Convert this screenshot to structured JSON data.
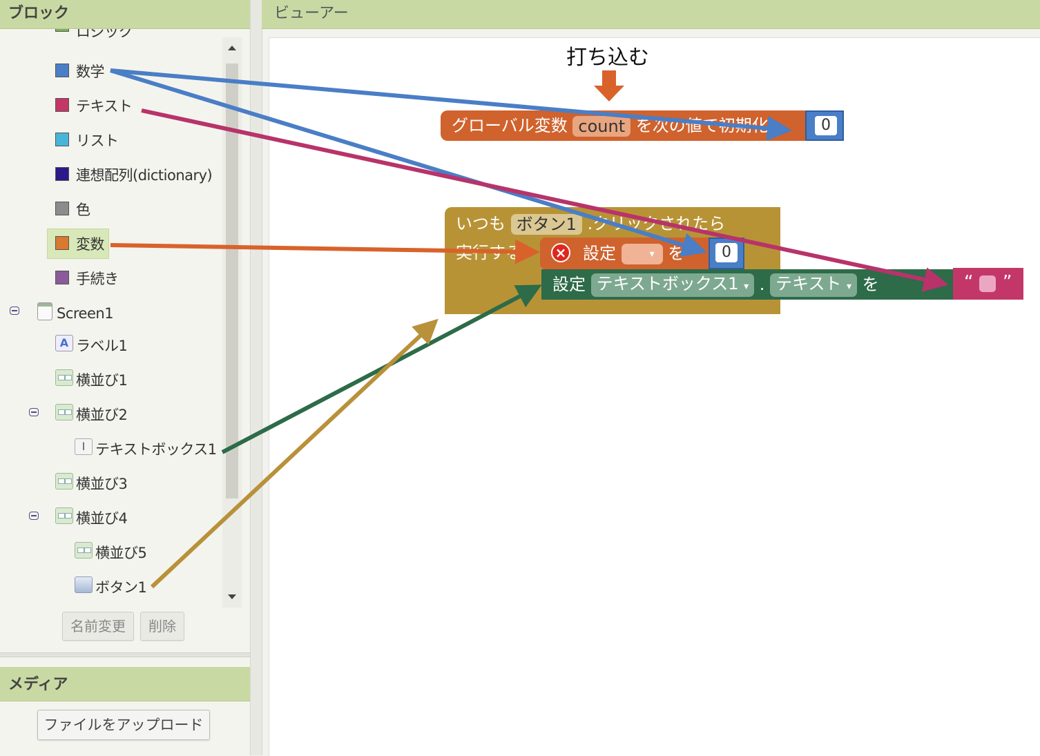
{
  "blocks_panel": {
    "title": "ブロック",
    "categories": [
      {
        "label": "ロジック",
        "color": "#7bb35a"
      },
      {
        "label": "数学",
        "color": "#4a7ec6"
      },
      {
        "label": "テキスト",
        "color": "#c33768"
      },
      {
        "label": "リスト",
        "color": "#49b4d9"
      },
      {
        "label": "連想配列(dictionary)",
        "color": "#2a1a8a"
      },
      {
        "label": "色",
        "color": "#8c8c8c"
      },
      {
        "label": "変数",
        "color": "#d9782f"
      },
      {
        "label": "手続き",
        "color": "#8a5a9a"
      }
    ],
    "selected_category": "変数",
    "components": [
      {
        "label": "Screen1",
        "icon": "screen-icon"
      },
      {
        "label": "ラベル1",
        "icon": "label-icon"
      },
      {
        "label": "横並び1",
        "icon": "arrangement-icon"
      },
      {
        "label": "横並び2",
        "icon": "arrangement-icon"
      },
      {
        "label": "テキストボックス1",
        "icon": "textbox-icon"
      },
      {
        "label": "横並び3",
        "icon": "arrangement-icon"
      },
      {
        "label": "横並び4",
        "icon": "arrangement-icon"
      },
      {
        "label": "横並び5",
        "icon": "arrangement-icon"
      },
      {
        "label": "ボタン1",
        "icon": "button-icon"
      }
    ],
    "rename_button": "名前変更",
    "delete_button": "削除"
  },
  "media_panel": {
    "title": "メディア",
    "upload_button": "ファイルをアップロード"
  },
  "viewer": {
    "title": "ビューアー",
    "annotation": "打ち込む",
    "global_block": {
      "prefix": "グローバル変数",
      "name": "count",
      "suffix": "を次の値で初期化",
      "value": "0"
    },
    "event_block": {
      "when": "いつも",
      "component": "ボタン1",
      "event": ".クリックされたら",
      "do": "実行する"
    },
    "set_var_block": {
      "label": "設定",
      "to": "を",
      "value": "0"
    },
    "set_prop_block": {
      "label": "設定",
      "component": "テキストボックス1",
      "dot": ".",
      "property": "テキスト",
      "to": "を"
    },
    "string_block": {
      "open": "“",
      "close": "”"
    }
  },
  "colors": {
    "header_bg": "#c9d9a3",
    "math_arrow": "#4a7ec6",
    "text_arrow": "#b8336a",
    "variable_arrow": "#d9622b",
    "textbox_arrow": "#2d6b49",
    "button_arrow": "#b8913a"
  }
}
